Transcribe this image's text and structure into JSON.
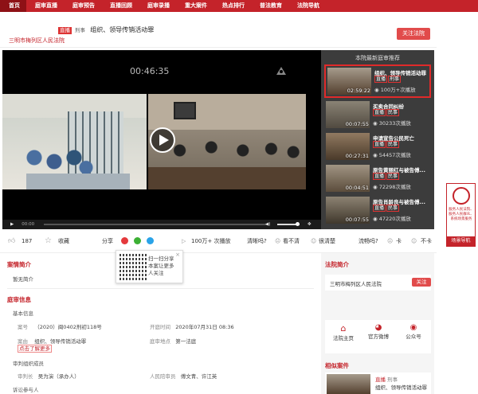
{
  "nav": [
    "首页",
    "庭审直播",
    "庭审预告",
    "直播回顾",
    "庭审录播",
    "重大案件",
    "热点排行",
    "普法教育",
    "法院导航"
  ],
  "case": {
    "tag1": "直播",
    "tag2": "刑事",
    "title": "组织、领导传销活动罪",
    "court": "三明市梅列区人民法院",
    "follow": "关注法院"
  },
  "player": {
    "time": "00:46:35",
    "current": "00:00"
  },
  "sidebar": {
    "title": "本院最新庭审推荐",
    "items": [
      {
        "title": "组织、领导传销活动罪",
        "tags": [
          "直播",
          "刑事"
        ],
        "views": "100万+次播放",
        "duration": "02:59:22"
      },
      {
        "title": "买卖合同纠纷",
        "tags": [
          "直播",
          "民事"
        ],
        "views": "30233次播放",
        "duration": "00:07:55"
      },
      {
        "title": "申请宣告公民死亡",
        "tags": [
          "直播",
          "民事"
        ],
        "views": "54457次播放",
        "duration": "00:27:31"
      },
      {
        "title": "原告黄丽红与被告傅...",
        "tags": [
          "直播",
          "民事"
        ],
        "views": "72298次播放",
        "duration": "00:04:51"
      },
      {
        "title": "原告肖龄良与被告傅...",
        "tags": [
          "直播",
          "民事"
        ],
        "views": "47220次播放",
        "duration": "00:07:55"
      }
    ]
  },
  "actions": {
    "likes": "187",
    "collect": "收藏",
    "share": "分享",
    "plays": "100万+",
    "plays_suffix": "次播放",
    "q1": "清晰吗?",
    "q2": "看不清",
    "q3": "很清楚",
    "q4": "流畅吗?",
    "q5": "卡",
    "q6": "不卡"
  },
  "qr": {
    "text": "扫一扫分享本案让更多人关注"
  },
  "intro": {
    "title": "案情简介",
    "text": "暂无简介"
  },
  "info": {
    "title": "庭审信息",
    "basic": "基本信息",
    "case_no_label": "案号",
    "case_no": "（2020）闽0402刑初118号",
    "open_time_label": "开庭时间",
    "open_time": "2020年07月31日 08:36",
    "reason_label": "案由",
    "reason": "组织、领导传销活动罪",
    "place_label": "庭审地点",
    "place": "第一法庭",
    "more": "点击了解更多",
    "members": "审判组织成员",
    "judge_label": "审判长",
    "judge": "吴为演（承办人）",
    "juror_label": "人民陪审员",
    "jurors": "傅文青、许江英",
    "participants": "诉讼参与人"
  },
  "court_intro": {
    "title": "法院简介",
    "name": "三明市梅列区人民法院",
    "follow": "关注",
    "home": "法院主页",
    "weibo": "官方微博",
    "wechat": "公众号"
  },
  "related": {
    "title": "相似案件",
    "tags": [
      "直播",
      "刑事"
    ],
    "text": "组织、领导传销活动罪"
  },
  "badge": {
    "text": "服务人民法院、服务人民群众、系统场景服务",
    "nav": "场景导航"
  }
}
